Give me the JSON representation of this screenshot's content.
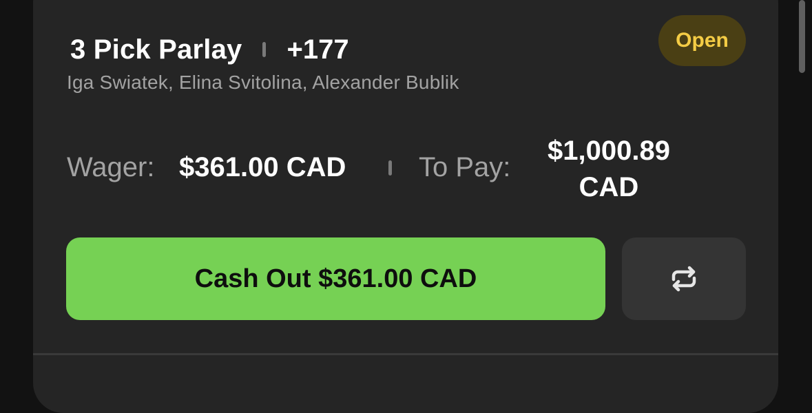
{
  "bet": {
    "title": "3 Pick Parlay",
    "odds": "+177",
    "status": "Open",
    "players": "Iga Swiatek, Elina Svitolina, Alexander Bublik"
  },
  "summary": {
    "wager_label": "Wager:",
    "wager_value": "$361.00 CAD",
    "to_pay_label": "To Pay:",
    "to_pay_amount": "$1,000.89",
    "to_pay_currency": "CAD"
  },
  "actions": {
    "cashout_label": "Cash Out $361.00 CAD",
    "repeat_icon": "repeat-icon"
  },
  "colors": {
    "background": "#121212",
    "card": "#252525",
    "accent_green": "#76d154",
    "status_text": "#f4cc45",
    "status_bg": "#4a3f14",
    "muted_text": "#a3a3a3"
  }
}
